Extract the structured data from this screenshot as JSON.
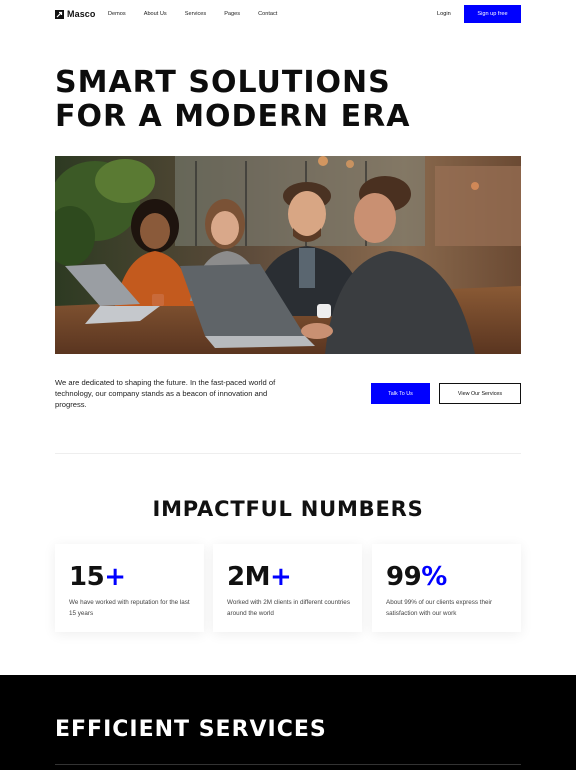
{
  "nav": {
    "brand": "Masco",
    "links": [
      "Demos",
      "About Us",
      "Services",
      "Pages",
      "Contact"
    ],
    "login": "Login",
    "signup": "Sign up free"
  },
  "hero": {
    "title_line1": "SMART SOLUTIONS",
    "title_line2": "FOR A MODERN ERA",
    "image_alt": "team-meeting-photo",
    "intro": "We are dedicated to shaping the future. In the fast-paced world of technology, our company stands as a beacon of innovation and progress.",
    "cta_primary": "Talk To Us",
    "cta_secondary": "View Our Services"
  },
  "numbers": {
    "title": "IMPACTFUL NUMBERS",
    "stats": [
      {
        "value": "15",
        "suffix": "+",
        "desc": "We have worked with reputation for the last 15 years"
      },
      {
        "value": "2M",
        "suffix": "+",
        "desc": "Worked with 2M clients in different countries around the world"
      },
      {
        "value": "99",
        "suffix": "%",
        "desc": "About 99% of our clients express their satisfaction with our work"
      }
    ]
  },
  "services": {
    "title": "EFFICIENT SERVICES"
  },
  "colors": {
    "accent": "#0000ff",
    "text": "#111111",
    "dark_section": "#000000"
  }
}
